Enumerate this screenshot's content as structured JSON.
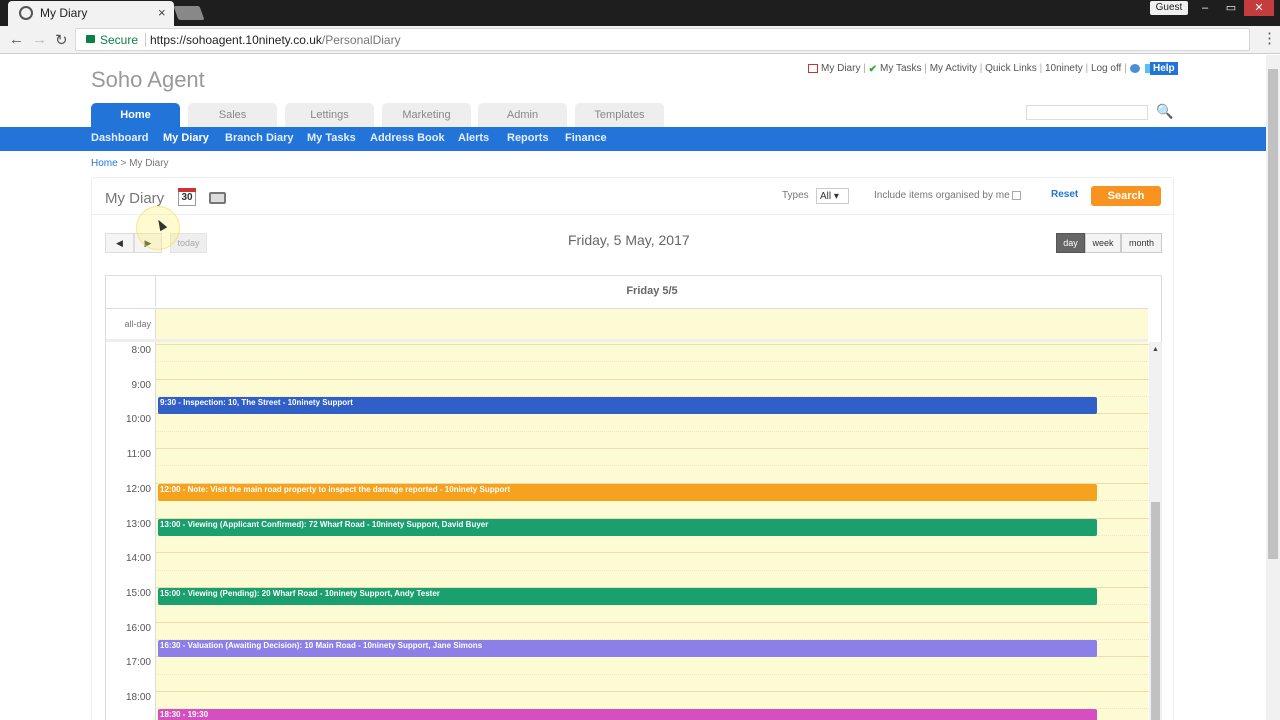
{
  "browser": {
    "tab_title": "My Diary",
    "tab_close": "×",
    "profile": "Guest",
    "secure_label": "Secure",
    "url_base": "https://sohoagent.10ninety.co.uk",
    "url_path": "/PersonalDiary",
    "window_buttons": [
      "–",
      "▭",
      "✕"
    ]
  },
  "site": {
    "logo": "Soho Agent",
    "top_links": [
      "My Diary",
      "My Tasks",
      "My Activity",
      "Quick Links",
      "10ninety",
      "Log off"
    ],
    "help": "Help",
    "main_tabs": [
      "Home",
      "Sales",
      "Lettings",
      "Marketing",
      "Admin",
      "Templates"
    ],
    "active_tab": "Home",
    "sub_nav": [
      "Dashboard",
      "My Diary",
      "Branch Diary",
      "My Tasks",
      "Address Book",
      "Alerts",
      "Reports",
      "Finance"
    ],
    "active_sub": "My Diary",
    "breadcrumb": {
      "home": "Home",
      "sep": ">",
      "current": "My Diary"
    }
  },
  "diary": {
    "title": "My Diary",
    "calendar_icon_num": "30",
    "types_label": "Types",
    "types_value": "All ▾",
    "include_label": "Include items organised by me",
    "reset": "Reset",
    "search": "Search",
    "prev": "◀",
    "next": "▶",
    "today": "today",
    "date_title": "Friday, 5 May, 2017",
    "views": [
      "day",
      "week",
      "month"
    ],
    "active_view": "day",
    "day_header": "Friday 5/5",
    "allday_label": "all-day",
    "hours": [
      "8:00",
      "9:00",
      "10:00",
      "11:00",
      "12:00",
      "13:00",
      "14:00",
      "15:00",
      "16:00",
      "17:00",
      "18:00"
    ],
    "events": [
      {
        "start": 9.5,
        "text": "9:30 - Inspection: 10, The Street - 10ninety Support",
        "color": "#2f5fc7"
      },
      {
        "start": 12.0,
        "text": "12:00 - Note: Visit the main road property to inspect the damage reported - 10ninety Support",
        "color": "#f7a21e"
      },
      {
        "start": 13.0,
        "text": "13:00 - Viewing (Applicant Confirmed): 72 Wharf Road - 10ninety Support, David Buyer",
        "color": "#1a9f6e"
      },
      {
        "start": 15.0,
        "text": "15:00 - Viewing (Pending): 20 Wharf Road - 10ninety Support, Andy Tester",
        "color": "#1a9f6e"
      },
      {
        "start": 16.5,
        "text": "16:30 - Valuation (Awaiting Decision): 10 Main Road - 10ninety Support, Jane Simons",
        "color": "#8c7fe8"
      },
      {
        "start": 18.5,
        "text": "18:30 - 19:30",
        "color": "#d44fbf"
      }
    ]
  }
}
